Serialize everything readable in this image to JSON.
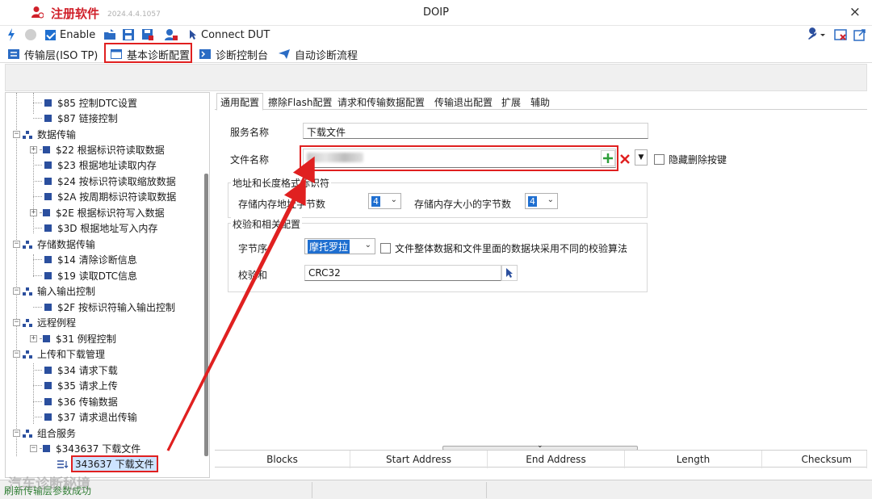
{
  "titlebar": {
    "app_name": "注册软件",
    "app_version": "2024.4.4.1057",
    "window_title": "DOIP",
    "close_glyph": "×"
  },
  "toolbar": {
    "enable_label": "Enable",
    "connect_label": "Connect DUT"
  },
  "main_tabs": [
    {
      "label": "传输层(ISO TP)"
    },
    {
      "label": "基本诊断配置"
    },
    {
      "label": "诊断控制台"
    },
    {
      "label": "自动诊断流程"
    }
  ],
  "tree": [
    {
      "label": "$85 控制DTC设置",
      "kind": "leaf"
    },
    {
      "label": "$87 链接控制",
      "kind": "leaf"
    },
    {
      "label": "数据传输",
      "kind": "category"
    },
    {
      "label": "$22 根据标识符读取数据",
      "kind": "leaf"
    },
    {
      "label": "$23 根据地址读取内存",
      "kind": "leaf"
    },
    {
      "label": "$24 按标识符读取缩放数据",
      "kind": "leaf"
    },
    {
      "label": "$2A 按周期标识符读取数据",
      "kind": "leaf"
    },
    {
      "label": "$2E 根据标识符写入数据",
      "kind": "leaf"
    },
    {
      "label": "$3D 根据地址写入内存",
      "kind": "leaf"
    },
    {
      "label": "存储数据传输",
      "kind": "category"
    },
    {
      "label": "$14 清除诊断信息",
      "kind": "leaf"
    },
    {
      "label": "$19 读取DTC信息",
      "kind": "leaf"
    },
    {
      "label": "输入输出控制",
      "kind": "category"
    },
    {
      "label": "$2F 按标识符输入输出控制",
      "kind": "leaf"
    },
    {
      "label": "远程例程",
      "kind": "category"
    },
    {
      "label": "$31 例程控制",
      "kind": "leaf"
    },
    {
      "label": "上传和下载管理",
      "kind": "category"
    },
    {
      "label": "$34 请求下载",
      "kind": "leaf"
    },
    {
      "label": "$35 请求上传",
      "kind": "leaf"
    },
    {
      "label": "$36 传输数据",
      "kind": "leaf"
    },
    {
      "label": "$37 请求退出传输",
      "kind": "leaf"
    },
    {
      "label": "组合服务",
      "kind": "category"
    },
    {
      "label": "$343637 下载文件",
      "kind": "leaf"
    },
    {
      "label": "343637 下载文件",
      "kind": "selected"
    }
  ],
  "config_tabs": [
    {
      "label": "通用配置"
    },
    {
      "label": "擦除Flash配置"
    },
    {
      "label": "请求和传输数据配置"
    },
    {
      "label": "传输退出配置"
    },
    {
      "label": "扩展"
    },
    {
      "label": "辅助"
    }
  ],
  "form": {
    "service_name_label": "服务名称",
    "service_name_value": "下载文件",
    "file_name_label": "文件名称",
    "hide_delete_label": "隐藏删除按键",
    "address_group_title": "地址和长度格式标识符",
    "storage_address_label": "存储内存地址字节数",
    "storage_address_value": "4",
    "storage_size_label": "存储内存大小的字节数",
    "storage_size_value": "4",
    "checksum_group_title": "校验和相关配置",
    "byte_order_label": "字节序",
    "byte_order_value": "摩托罗拉",
    "diff_algo_label": "文件整体数据和文件里面的数据块采用不同的校验算法",
    "checksum_label": "校验和",
    "checksum_value": "CRC32"
  },
  "table": {
    "columns": [
      "Blocks",
      "Start Address",
      "End Address",
      "Length",
      "Checksum"
    ]
  },
  "statusbar": {
    "text": "刷新传输层参数成功"
  },
  "watermark": "汽车诊断秘境",
  "colors": {
    "highlight_red": "#e02020",
    "brand_red": "#d0202a",
    "accent_blue": "#1f6fd0",
    "tree_icon_blue": "#2b4f9e",
    "status_green": "#2e7d32"
  }
}
